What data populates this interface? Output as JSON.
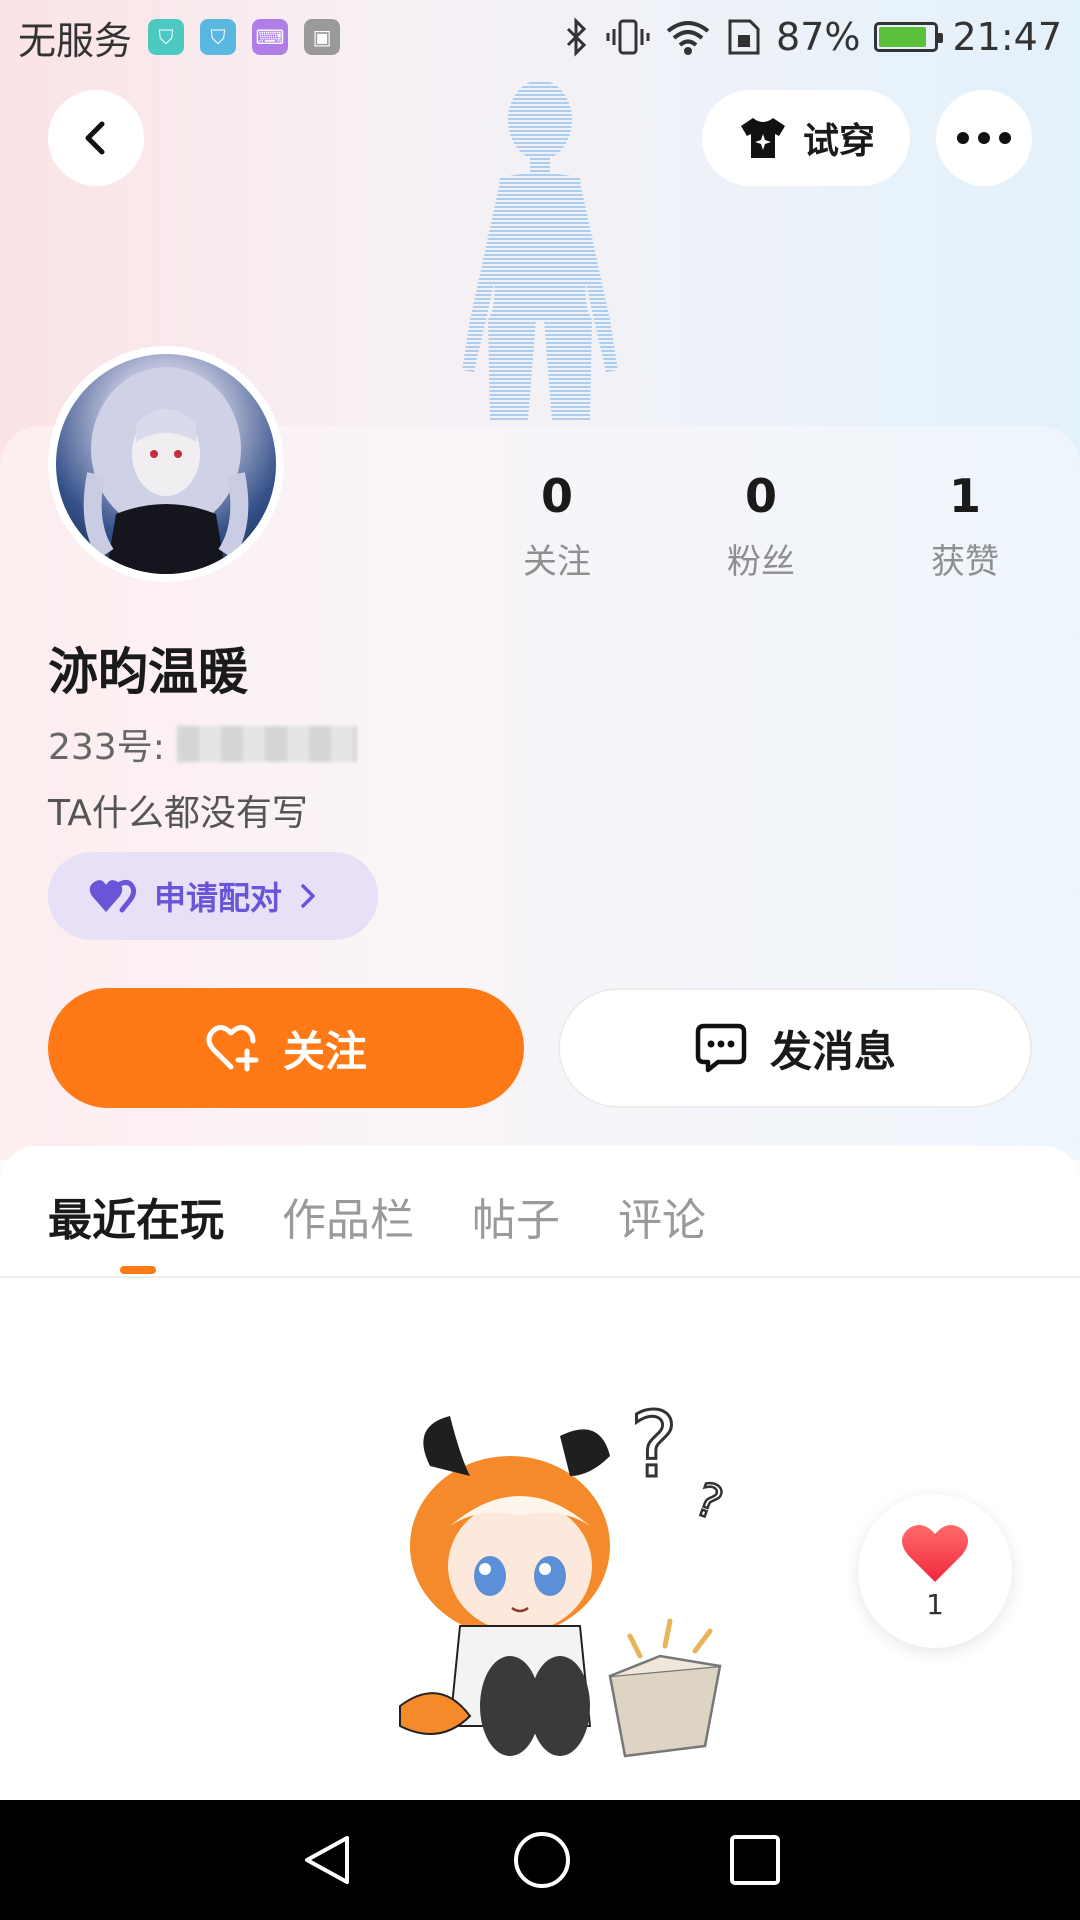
{
  "status_bar": {
    "carrier": "无服务",
    "battery": "87%",
    "battery_level": 0.87,
    "time": "21:47"
  },
  "header": {
    "tryon_label": "试穿"
  },
  "profile": {
    "username": "洂昀温暖",
    "id_label": "233号:",
    "bio": "TA什么都没有写",
    "pair_label": "申请配对",
    "stats": [
      {
        "value": "0",
        "label": "关注"
      },
      {
        "value": "0",
        "label": "粉丝"
      },
      {
        "value": "1",
        "label": "获赞"
      }
    ]
  },
  "actions": {
    "follow_label": "关注",
    "message_label": "发消息"
  },
  "tabs": [
    "最近在玩",
    "作品栏",
    "帖子",
    "评论"
  ],
  "like_fab": {
    "count": "1"
  },
  "colors": {
    "accent": "#ff7a16",
    "pair_bg": "#e7e0f6",
    "pair_text": "#6a55d8"
  }
}
